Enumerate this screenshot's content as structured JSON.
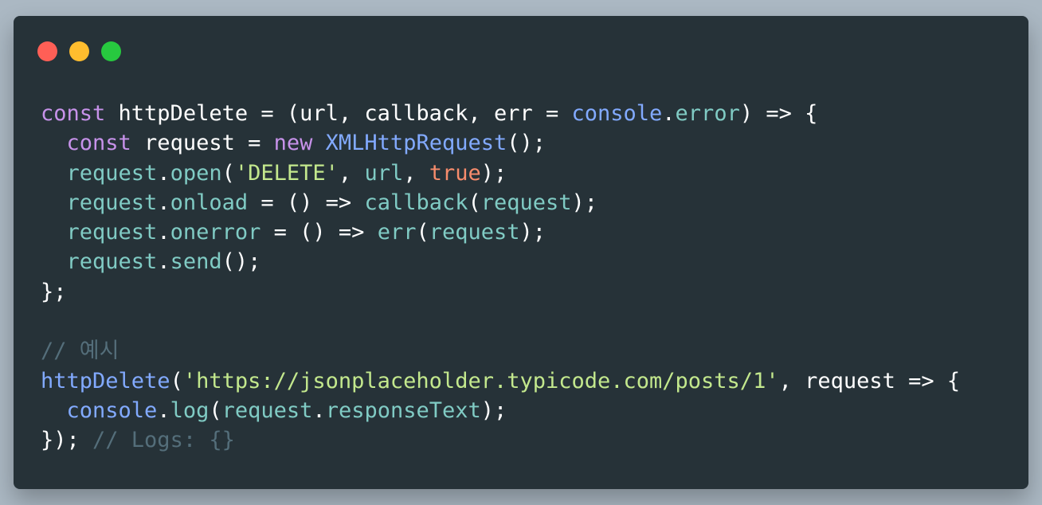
{
  "theme": {
    "background": "#abb8c3",
    "window": "#263238",
    "keyword": "#c792ea",
    "function": "#82aaff",
    "property": "#80cbc4",
    "string": "#c3e88d",
    "boolean": "#f78c6c",
    "comment": "#546e7a",
    "text": "#ffffff"
  },
  "window_controls": [
    {
      "name": "close",
      "color": "#ff5f56"
    },
    {
      "name": "minimize",
      "color": "#ffbd2e"
    },
    {
      "name": "maximize",
      "color": "#27c93f"
    }
  ],
  "code": {
    "lines": [
      [
        {
          "t": "const",
          "c": "kw"
        },
        {
          "t": " httpDelete = (url, callback, err = ",
          "c": "plain"
        },
        {
          "t": "console",
          "c": "fn"
        },
        {
          "t": ".",
          "c": "plain"
        },
        {
          "t": "error",
          "c": "prop"
        },
        {
          "t": ") => {",
          "c": "plain"
        }
      ],
      [
        {
          "t": "  ",
          "c": "plain"
        },
        {
          "t": "const",
          "c": "kw"
        },
        {
          "t": " request = ",
          "c": "plain"
        },
        {
          "t": "new",
          "c": "kw"
        },
        {
          "t": " ",
          "c": "plain"
        },
        {
          "t": "XMLHttpRequest",
          "c": "fn"
        },
        {
          "t": "();",
          "c": "plain"
        }
      ],
      [
        {
          "t": "  ",
          "c": "plain"
        },
        {
          "t": "request",
          "c": "prop"
        },
        {
          "t": ".",
          "c": "plain"
        },
        {
          "t": "open",
          "c": "prop"
        },
        {
          "t": "(",
          "c": "plain"
        },
        {
          "t": "'DELETE'",
          "c": "str"
        },
        {
          "t": ", ",
          "c": "plain"
        },
        {
          "t": "url",
          "c": "prop"
        },
        {
          "t": ", ",
          "c": "plain"
        },
        {
          "t": "true",
          "c": "bool"
        },
        {
          "t": ");",
          "c": "plain"
        }
      ],
      [
        {
          "t": "  ",
          "c": "plain"
        },
        {
          "t": "request",
          "c": "prop"
        },
        {
          "t": ".",
          "c": "plain"
        },
        {
          "t": "onload",
          "c": "prop"
        },
        {
          "t": " = () => ",
          "c": "plain"
        },
        {
          "t": "callback",
          "c": "prop"
        },
        {
          "t": "(",
          "c": "plain"
        },
        {
          "t": "request",
          "c": "prop"
        },
        {
          "t": ");",
          "c": "plain"
        }
      ],
      [
        {
          "t": "  ",
          "c": "plain"
        },
        {
          "t": "request",
          "c": "prop"
        },
        {
          "t": ".",
          "c": "plain"
        },
        {
          "t": "onerror",
          "c": "prop"
        },
        {
          "t": " = () => ",
          "c": "plain"
        },
        {
          "t": "err",
          "c": "prop"
        },
        {
          "t": "(",
          "c": "plain"
        },
        {
          "t": "request",
          "c": "prop"
        },
        {
          "t": ");",
          "c": "plain"
        }
      ],
      [
        {
          "t": "  ",
          "c": "plain"
        },
        {
          "t": "request",
          "c": "prop"
        },
        {
          "t": ".",
          "c": "plain"
        },
        {
          "t": "send",
          "c": "prop"
        },
        {
          "t": "();",
          "c": "plain"
        }
      ],
      [
        {
          "t": "};",
          "c": "plain"
        }
      ],
      [],
      [
        {
          "t": "// 예시",
          "c": "cmt"
        }
      ],
      [
        {
          "t": "httpDelete",
          "c": "fn"
        },
        {
          "t": "(",
          "c": "plain"
        },
        {
          "t": "'https://jsonplaceholder.typicode.com/posts/1'",
          "c": "str"
        },
        {
          "t": ", request => {",
          "c": "plain"
        }
      ],
      [
        {
          "t": "  ",
          "c": "plain"
        },
        {
          "t": "console",
          "c": "fn"
        },
        {
          "t": ".",
          "c": "plain"
        },
        {
          "t": "log",
          "c": "prop"
        },
        {
          "t": "(",
          "c": "plain"
        },
        {
          "t": "request",
          "c": "prop"
        },
        {
          "t": ".",
          "c": "plain"
        },
        {
          "t": "responseText",
          "c": "prop"
        },
        {
          "t": ");",
          "c": "plain"
        }
      ],
      [
        {
          "t": "}); ",
          "c": "plain"
        },
        {
          "t": "// Logs: {}",
          "c": "cmt"
        }
      ]
    ]
  }
}
